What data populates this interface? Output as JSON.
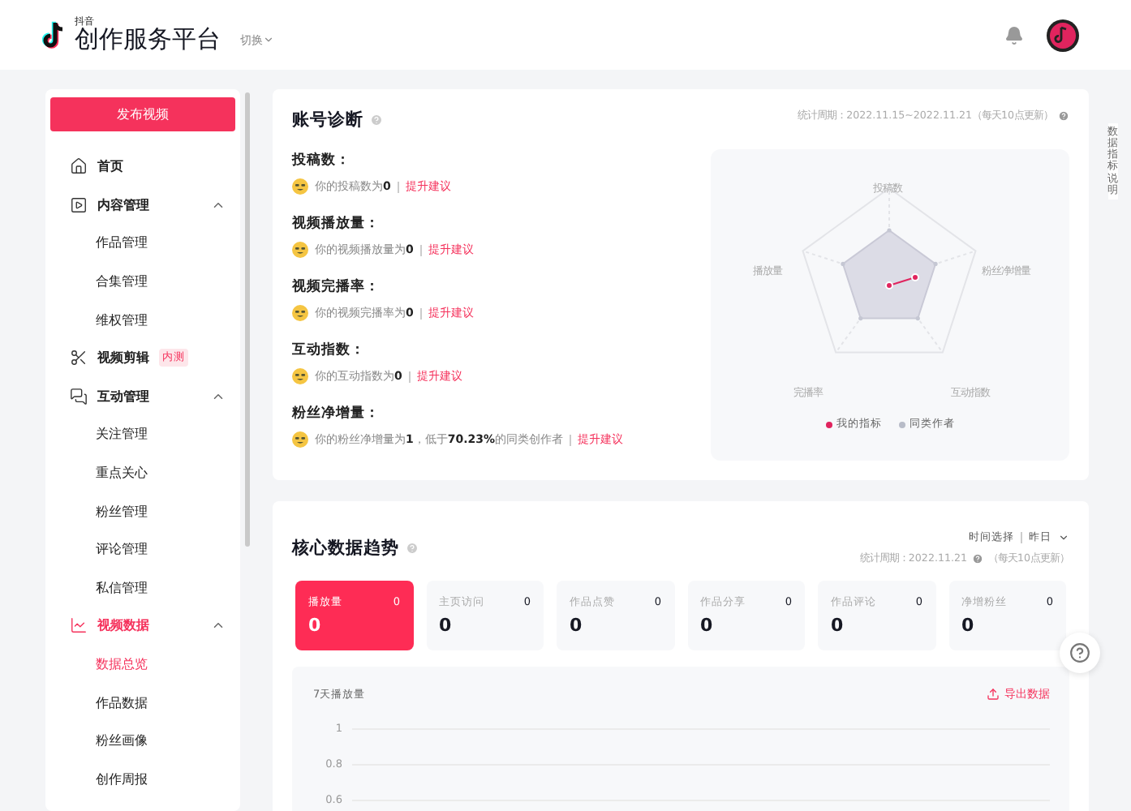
{
  "header": {
    "logo_small": "抖音",
    "logo_title": "创作服务平台",
    "switch": "切换"
  },
  "sidebar": {
    "publish_button": "发布视频",
    "items": [
      {
        "label": "首页",
        "kind": "home",
        "selected": false
      },
      {
        "label": "内容管理",
        "kind": "play",
        "expanded": true,
        "selected": false,
        "children": [
          {
            "label": "作品管理",
            "selected": false
          },
          {
            "label": "合集管理",
            "selected": false
          },
          {
            "label": "维权管理",
            "selected": false
          }
        ]
      },
      {
        "label": "视频剪辑",
        "kind": "scissors",
        "badge": "内测",
        "selected": false
      },
      {
        "label": "互动管理",
        "kind": "chat",
        "expanded": true,
        "selected": false,
        "children": [
          {
            "label": "关注管理",
            "selected": false
          },
          {
            "label": "重点关心",
            "selected": false
          },
          {
            "label": "粉丝管理",
            "selected": false
          },
          {
            "label": "评论管理",
            "selected": false
          },
          {
            "label": "私信管理",
            "selected": false
          }
        ]
      },
      {
        "label": "视频数据",
        "kind": "chart",
        "expanded": true,
        "selected": true,
        "children": [
          {
            "label": "数据总览",
            "selected": true
          },
          {
            "label": "作品数据",
            "selected": false
          },
          {
            "label": "粉丝画像",
            "selected": false
          },
          {
            "label": "创作周报",
            "selected": false
          }
        ]
      }
    ]
  },
  "diagnosis": {
    "title": "账号诊断",
    "period": "统计周期：2022.11.15~2022.11.21（每天10点更新）",
    "items": [
      {
        "label": "投稿数：",
        "text": "你的投稿数为**0**",
        "link": "提升建议"
      },
      {
        "label": "视频播放量：",
        "text": "你的视频播放量为**0**",
        "link": "提升建议"
      },
      {
        "label": "视频完播率：",
        "text": "你的视频完播率为**0**",
        "link": "提升建议"
      },
      {
        "label": "互动指数：",
        "text": "你的互动指数为**0**",
        "link": "提升建议"
      },
      {
        "label": "粉丝净增量：",
        "text": "你的粉丝净增量为**1**，低于**70.23%**的同类创作者",
        "link": "提升建议"
      }
    ],
    "radar": {
      "axes": [
        "投稿数",
        "播放量",
        "粉丝净增量",
        "完播率",
        "互动指数"
      ],
      "legend": [
        {
          "label": "我的指标",
          "color": "#e0245e"
        },
        {
          "label": "同类作者",
          "color": "#b8bcc8"
        }
      ]
    }
  },
  "side_tab": "数据指标说明",
  "trend": {
    "title": "核心数据趋势",
    "time_label": "时间选择",
    "time_value": "昨日",
    "period": "统计周期：2022.11.21",
    "period_note": "（每天10点更新）",
    "metrics": [
      {
        "label": "播放量",
        "change": "0",
        "value": "0",
        "selected": true
      },
      {
        "label": "主页访问",
        "change": "0",
        "value": "0",
        "selected": false
      },
      {
        "label": "作品点赞",
        "change": "0",
        "value": "0",
        "selected": false
      },
      {
        "label": "作品分享",
        "change": "0",
        "value": "0",
        "selected": false
      },
      {
        "label": "作品评论",
        "change": "0",
        "value": "0",
        "selected": false
      },
      {
        "label": "净增粉丝",
        "change": "0",
        "value": "0",
        "selected": false
      }
    ],
    "chart_title": "7天播放量",
    "export": "导出数据",
    "y_axis_labels": [
      "1",
      "0.8",
      "0.6"
    ]
  }
}
